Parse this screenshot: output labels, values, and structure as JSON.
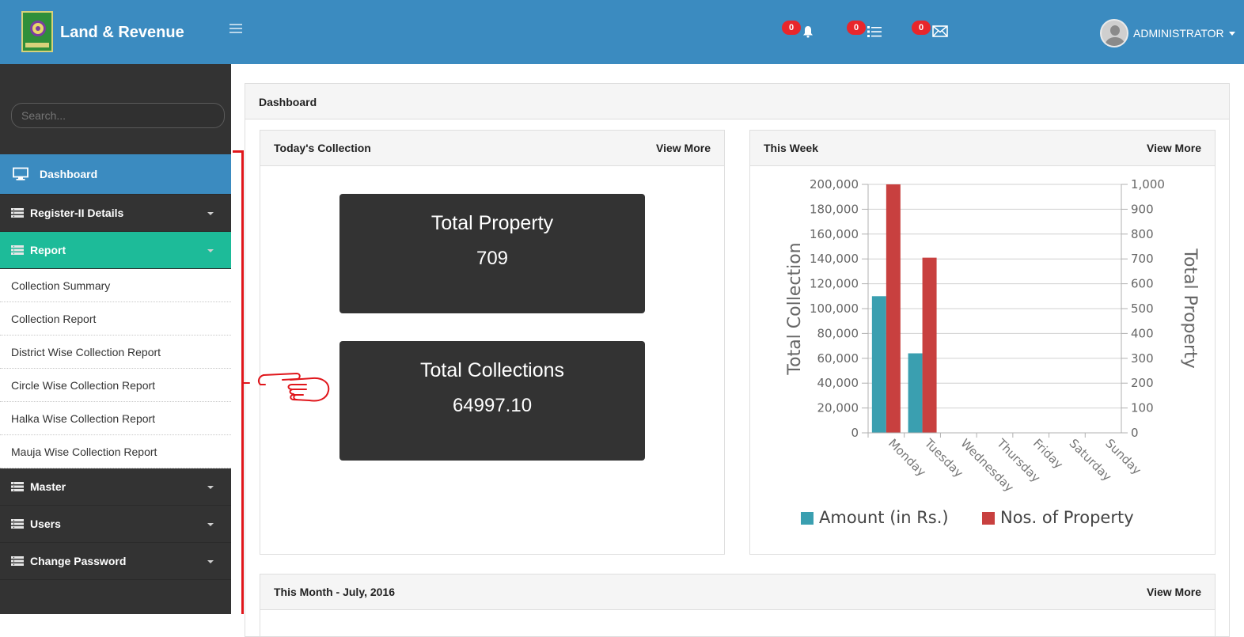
{
  "header": {
    "brand_title": "Land & Revenue",
    "notifications": [
      {
        "icon": "bell-icon",
        "count": "0"
      },
      {
        "icon": "list-icon",
        "count": "0"
      },
      {
        "icon": "envelope-icon",
        "count": "0"
      }
    ],
    "user_name": "ADMINISTRATOR"
  },
  "sidebar": {
    "search_placeholder": "Search...",
    "items": [
      {
        "label": "Dashboard",
        "icon": "monitor-icon"
      },
      {
        "label": "Register-II Details",
        "icon": "list-icon"
      },
      {
        "label": "Report",
        "icon": "list-icon"
      },
      {
        "label": "Master",
        "icon": "list-icon"
      },
      {
        "label": "Users",
        "icon": "list-icon"
      },
      {
        "label": "Change Password",
        "icon": "list-icon"
      }
    ],
    "report_submenu": [
      "Collection Summary",
      "Collection Report",
      "District Wise Collection Report",
      "Circle Wise Collection Report",
      "Halka Wise Collection Report",
      "Mauja Wise Collection Report"
    ]
  },
  "colors": {
    "topbar": "#3b8bc0",
    "sidebar": "#333333",
    "report_active": "#1dbb99",
    "badge": "#e8262b",
    "series_amount": "#3a9fb0",
    "series_property": "#c8403f",
    "annotation": "#e0161b"
  },
  "main": {
    "panel_title": "Dashboard",
    "today": {
      "title": "Today's Collection",
      "view_more": "View More",
      "total_property_label": "Total Property",
      "total_property_value": "709",
      "total_collections_label": "Total Collections",
      "total_collections_value": "64997.10"
    },
    "week": {
      "title": "This Week",
      "view_more": "View More"
    },
    "month": {
      "title": "This Month - July, 2016",
      "view_more": "View More"
    }
  },
  "chart_data": {
    "type": "bar",
    "categories": [
      "Monday",
      "Tuesday",
      "Wednesday",
      "Thursday",
      "Friday",
      "Saturday",
      "Sunday"
    ],
    "series": [
      {
        "name": "Amount (in Rs.)",
        "axis": "left",
        "values": [
          110000,
          64000,
          0,
          0,
          0,
          0,
          0
        ]
      },
      {
        "name": "Nos. of Property",
        "axis": "right",
        "values": [
          1000,
          705,
          0,
          0,
          0,
          0,
          0
        ]
      }
    ],
    "ylabel": "Total Collection",
    "y2label": "Total Property",
    "ylim": [
      0,
      200000
    ],
    "y2lim": [
      0,
      1000
    ],
    "yticks": [
      "0",
      "20,000",
      "40,000",
      "60,000",
      "80,000",
      "100,000",
      "120,000",
      "140,000",
      "160,000",
      "180,000",
      "200,000"
    ],
    "y2ticks": [
      "0",
      "100",
      "200",
      "300",
      "400",
      "500",
      "600",
      "700",
      "800",
      "900",
      "1,000"
    ],
    "grid": true,
    "legend": "bottom"
  }
}
